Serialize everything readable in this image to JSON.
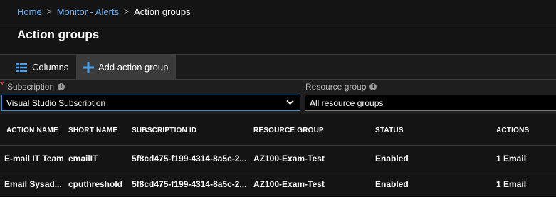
{
  "breadcrumb": {
    "items": [
      "Home",
      "Monitor - Alerts",
      "Action groups"
    ]
  },
  "page": {
    "title": "Action groups"
  },
  "toolbar": {
    "columns_label": "Columns",
    "add_label": "Add action group"
  },
  "filters": {
    "subscription_label": "Subscription",
    "subscription_required": "*",
    "subscription_value": "Visual Studio Subscription",
    "resource_group_label": "Resource group",
    "resource_group_value": "All resource groups",
    "info_glyph": "i"
  },
  "table": {
    "headers": [
      "ACTION NAME",
      "SHORT NAME",
      "SUBSCRIPTION ID",
      "RESOURCE GROUP",
      "STATUS",
      "ACTIONS"
    ],
    "rows": [
      [
        "E-mail IT Team",
        "emailIT",
        "5f8cd475-f199-4314-8a5c-2...",
        "AZ100-Exam-Test",
        "Enabled",
        "1 Email"
      ],
      [
        "Email Sysad...",
        "cputhreshold",
        "5f8cd475-f199-4314-8a5c-2...",
        "AZ100-Exam-Test",
        "Enabled",
        "1 Email"
      ]
    ]
  },
  "colors": {
    "link": "#6ab0f3",
    "accent": "#3c8ad8",
    "required": "#ff5555"
  },
  "icons": {
    "columns": "columns-icon",
    "add": "plus-icon",
    "info": "info-icon",
    "dropdown": "chevron-down-icon"
  }
}
